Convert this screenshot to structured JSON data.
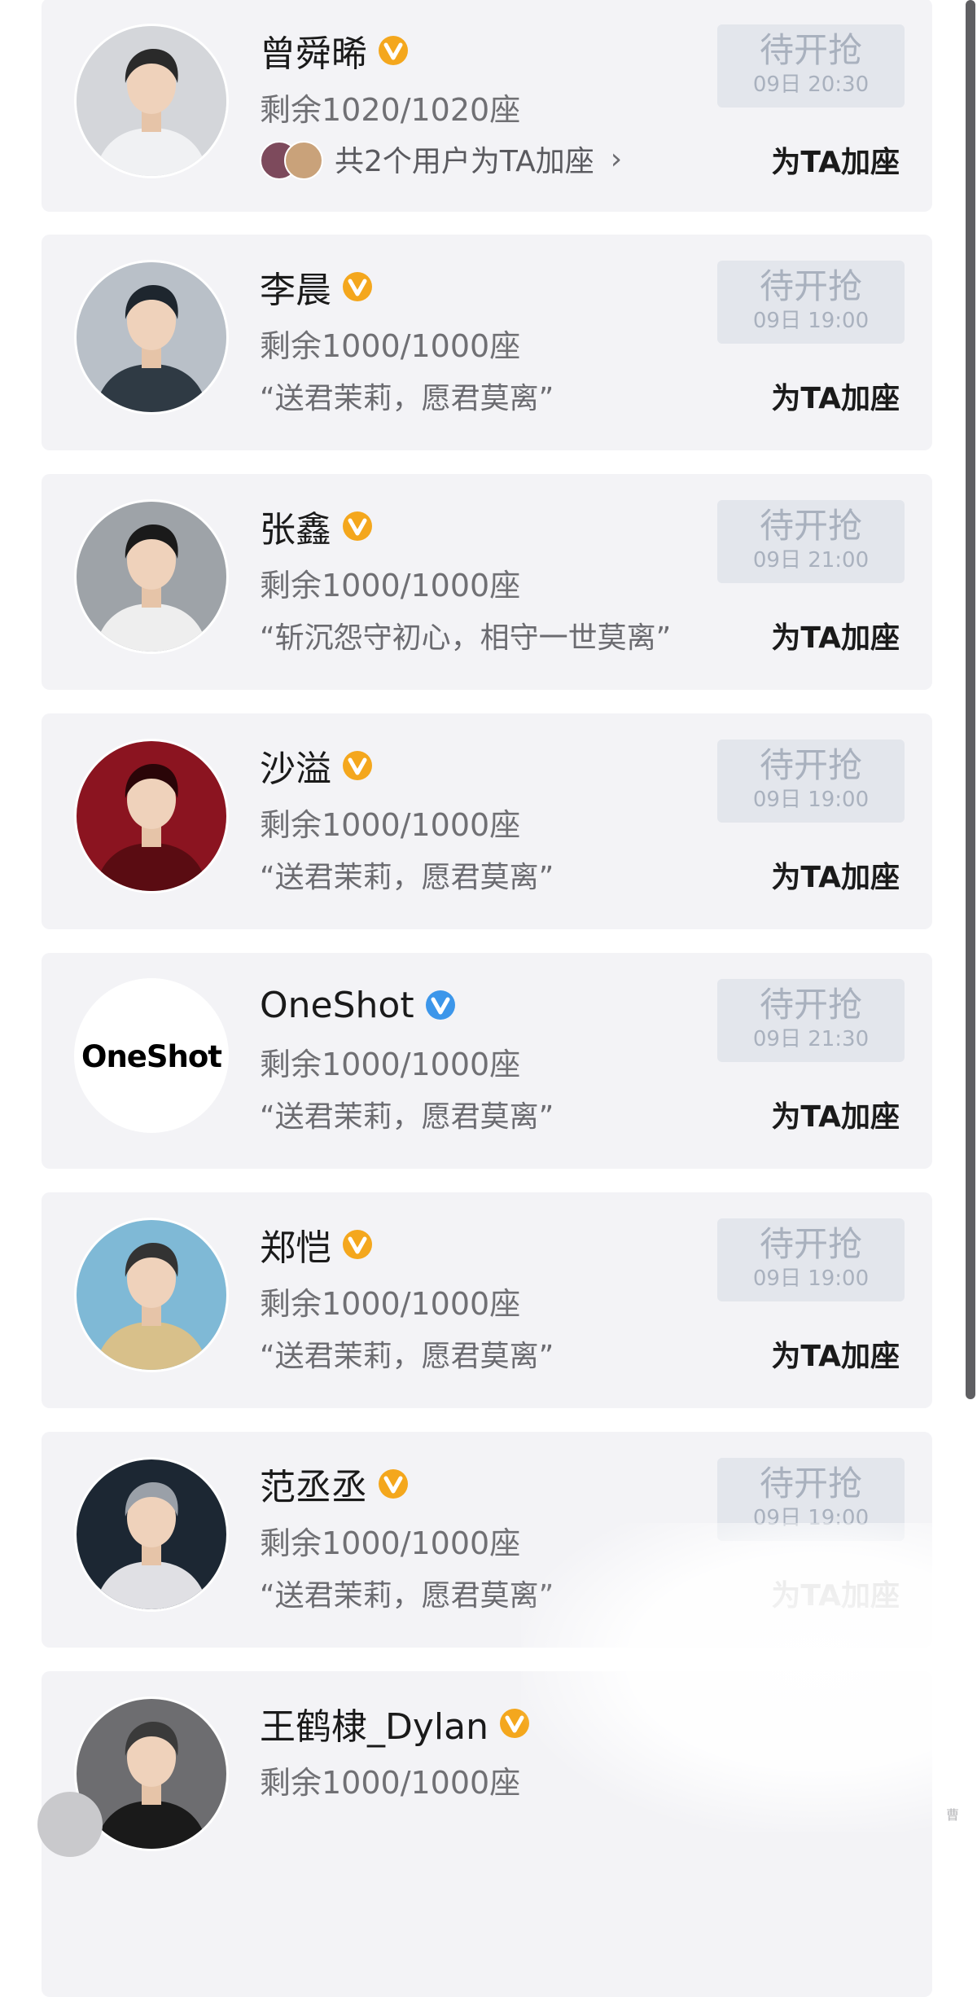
{
  "colors": {
    "card_bg": "#f3f3f6",
    "button_bg": "#e3e6ec",
    "button_text": "#a9b1be",
    "badge_orange": "#f4a71d",
    "badge_blue": "#3c96ea"
  },
  "entries": [
    {
      "name": "曾舜晞",
      "badge": "orange-v-badge-icon",
      "remaining": "剩余1020/1020座",
      "supporters": {
        "text": "共2个用户为TA加座",
        "arrow": "›"
      },
      "quote": "",
      "button_label": "待开抢",
      "button_time": "09日 20:30",
      "add_seat": "为TA加座",
      "avatar": "portrait-icon"
    },
    {
      "name": "李晨",
      "badge": "orange-v-badge-icon",
      "remaining": "剩余1000/1000座",
      "quote": "“送君茉莉，愿君莫离”",
      "button_label": "待开抢",
      "button_time": "09日 19:00",
      "add_seat": "为TA加座",
      "avatar": "portrait-icon"
    },
    {
      "name": "张鑫",
      "badge": "orange-v-badge-icon",
      "remaining": "剩余1000/1000座",
      "quote": "“斩沉怨守初心，相守一世莫离”",
      "button_label": "待开抢",
      "button_time": "09日 21:00",
      "add_seat": "为TA加座",
      "avatar": "portrait-icon"
    },
    {
      "name": "沙溢",
      "badge": "orange-v-badge-icon",
      "remaining": "剩余1000/1000座",
      "quote": "“送君茉莉，愿君莫离”",
      "button_label": "待开抢",
      "button_time": "09日 19:00",
      "add_seat": "为TA加座",
      "avatar": "portrait-icon"
    },
    {
      "name": "OneShot",
      "badge": "blue-v-badge-icon",
      "remaining": "剩余1000/1000座",
      "quote": "“送君茉莉，愿君莫离”",
      "button_label": "待开抢",
      "button_time": "09日 21:30",
      "add_seat": "为TA加座",
      "avatar": "logo",
      "logo_text": "OneShot"
    },
    {
      "name": "郑恺",
      "badge": "orange-v-badge-icon",
      "remaining": "剩余1000/1000座",
      "quote": "“送君茉莉，愿君莫离”",
      "button_label": "待开抢",
      "button_time": "09日 19:00",
      "add_seat": "为TA加座",
      "avatar": "portrait-icon"
    },
    {
      "name": "范丞丞",
      "badge": "orange-v-badge-icon",
      "remaining": "剩余1000/1000座",
      "quote": "“送君茉莉，愿君莫离”",
      "button_label": "待开抢",
      "button_time": "09日 19:00",
      "add_seat": "为TA加座",
      "avatar": "portrait-icon"
    },
    {
      "name": "王鹤棣_Dylan",
      "badge": "orange-v-badge-icon",
      "remaining": "剩余1000/1000座",
      "quote": "",
      "button_label": "",
      "button_time": "",
      "add_seat": "",
      "avatar": "portrait-icon"
    }
  ],
  "watermark": "曹"
}
